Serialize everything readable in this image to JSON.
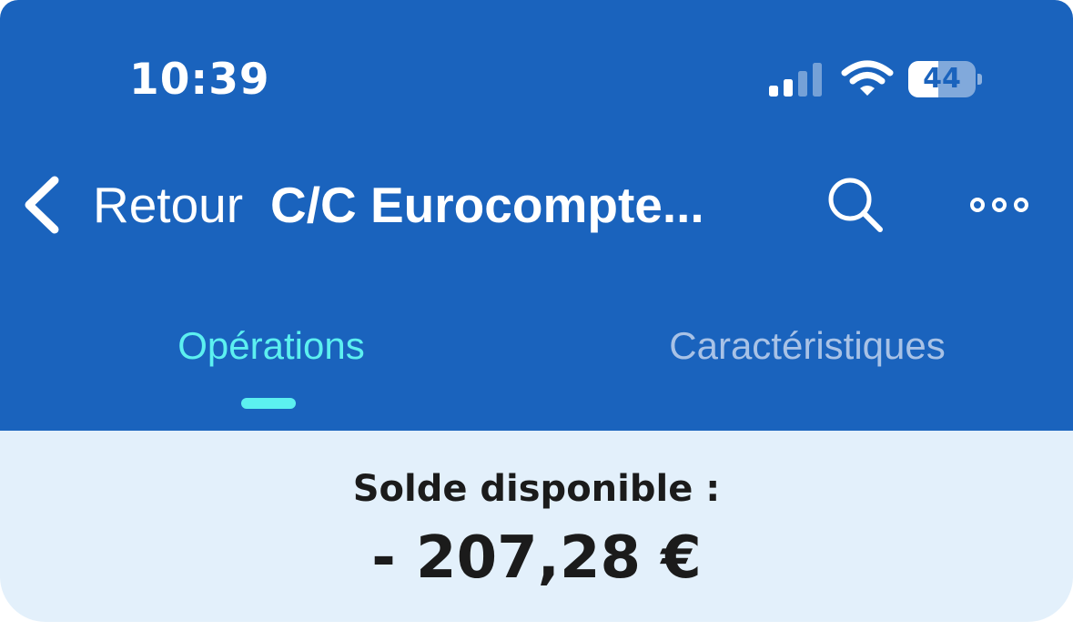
{
  "status_bar": {
    "time": "10:39",
    "battery_level": "44",
    "battery_fraction": 0.44
  },
  "nav": {
    "back_label": "Retour",
    "title": "C/C Eurocompte...",
    "icons": [
      "chevron-left-icon",
      "search-icon",
      "more-icon"
    ]
  },
  "tabs": [
    {
      "label": "Opérations",
      "active": true
    },
    {
      "label": "Caractéristiques",
      "active": false
    }
  ],
  "balance": {
    "label": "Solde disponible :",
    "amount": "- 207,28 €"
  },
  "colors": {
    "header_bg": "#1a63bd",
    "active_tab": "#5cf0f0",
    "inactive_tab": "#a8c2e6",
    "balance_bg": "#e3f0fb",
    "text_dark": "#1b1b1b"
  }
}
